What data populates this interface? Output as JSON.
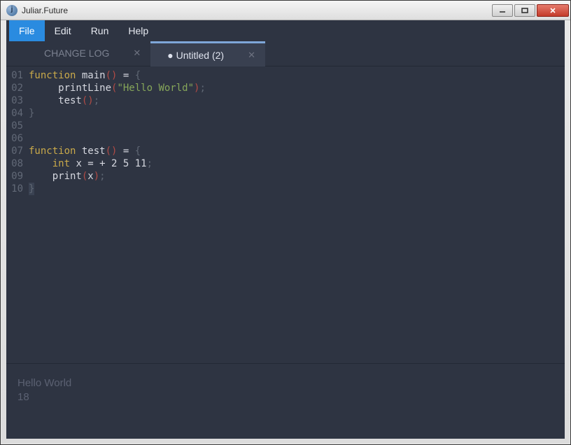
{
  "window": {
    "title": "Juliar.Future"
  },
  "menu": {
    "items": [
      "File",
      "Edit",
      "Run",
      "Help"
    ],
    "active_index": 0
  },
  "tabs": {
    "items": [
      {
        "label": "CHANGE LOG",
        "active": false,
        "dirty": false
      },
      {
        "label": "Untitled (2)",
        "active": true,
        "dirty": true
      }
    ]
  },
  "editor": {
    "line_numbers": [
      "01",
      "02",
      "03",
      "04",
      "05",
      "06",
      "07",
      "08",
      "09",
      "10"
    ],
    "lines": [
      [
        {
          "t": "function ",
          "c": "kw"
        },
        {
          "t": "main",
          "c": "fn"
        },
        {
          "t": "()",
          "c": "pn"
        },
        {
          "t": " = ",
          "c": "id"
        },
        {
          "t": "{",
          "c": "br"
        }
      ],
      [
        {
          "t": "     printLine",
          "c": "fn"
        },
        {
          "t": "(",
          "c": "pn"
        },
        {
          "t": "\"Hello World\"",
          "c": "str"
        },
        {
          "t": ")",
          "c": "pn"
        },
        {
          "t": ";",
          "c": "sc"
        }
      ],
      [
        {
          "t": "     test",
          "c": "fn"
        },
        {
          "t": "()",
          "c": "pn"
        },
        {
          "t": ";",
          "c": "sc"
        }
      ],
      [
        {
          "t": "}",
          "c": "br"
        }
      ],
      [],
      [],
      [
        {
          "t": "function ",
          "c": "kw"
        },
        {
          "t": "test",
          "c": "fn"
        },
        {
          "t": "()",
          "c": "pn"
        },
        {
          "t": " = ",
          "c": "id"
        },
        {
          "t": "{",
          "c": "br"
        }
      ],
      [
        {
          "t": "    ",
          "c": "id"
        },
        {
          "t": "int ",
          "c": "ty"
        },
        {
          "t": "x = + 2 5 11",
          "c": "n"
        },
        {
          "t": ";",
          "c": "sc"
        }
      ],
      [
        {
          "t": "    print",
          "c": "fn"
        },
        {
          "t": "(",
          "c": "pn"
        },
        {
          "t": "x",
          "c": "id"
        },
        {
          "t": ")",
          "c": "pn"
        },
        {
          "t": ";",
          "c": "sc"
        }
      ],
      [
        {
          "t": "}",
          "c": "br",
          "hl": true
        }
      ]
    ]
  },
  "output": {
    "lines": [
      "Hello World",
      "18"
    ]
  }
}
